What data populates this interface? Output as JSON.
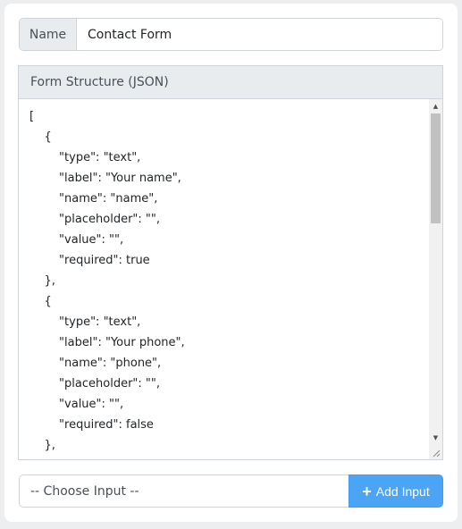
{
  "name_field": {
    "label": "Name",
    "value": "Contact Form"
  },
  "structure_panel": {
    "header": "Form Structure (JSON)",
    "json_lines": [
      "[",
      "    {",
      "        \"type\": \"text\",",
      "        \"label\": \"Your name\",",
      "        \"name\": \"name\",",
      "        \"placeholder\": \"\",",
      "        \"value\": \"\",",
      "        \"required\": true",
      "    },",
      "    {",
      "        \"type\": \"text\",",
      "        \"label\": \"Your phone\",",
      "        \"name\": \"phone\",",
      "        \"placeholder\": \"\",",
      "        \"value\": \"\",",
      "        \"required\": false",
      "    },"
    ]
  },
  "input_picker": {
    "selected": "-- Choose Input --"
  },
  "add_button": {
    "label": "Add Input",
    "icon": "plus-icon"
  },
  "colors": {
    "accent": "#4ba4f6",
    "addon_bg": "#e9ecef",
    "border": "#ced4da"
  }
}
